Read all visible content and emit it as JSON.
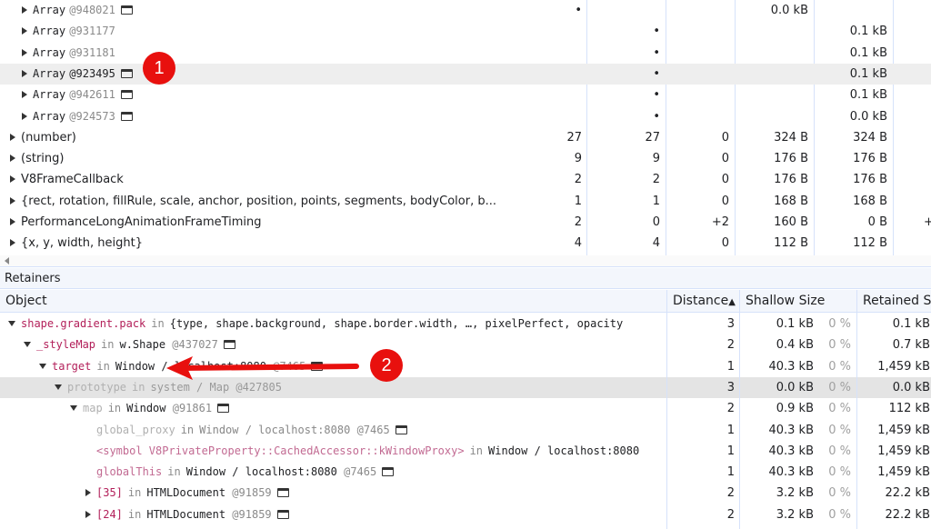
{
  "top_table": {
    "rows": [
      {
        "indent": 2,
        "name": "Array",
        "id": "@948021",
        "win": true,
        "c1": "•",
        "c2": "",
        "c3": "",
        "c4": "0.0 kB",
        "c5": "",
        "c6": ""
      },
      {
        "indent": 2,
        "name": "Array",
        "id": "@931177",
        "win": false,
        "c1": "",
        "c2": "•",
        "c3": "",
        "c4": "",
        "c5": "0.1 kB",
        "c6": ""
      },
      {
        "indent": 2,
        "name": "Array",
        "id": "@931181",
        "win": false,
        "c1": "",
        "c2": "•",
        "c3": "",
        "c4": "",
        "c5": "0.1 kB",
        "c6": ""
      },
      {
        "indent": 2,
        "name": "Array",
        "id": "@923495",
        "win": true,
        "selected": true,
        "c1": "",
        "c2": "•",
        "c3": "",
        "c4": "",
        "c5": "0.1 kB",
        "c6": ""
      },
      {
        "indent": 2,
        "name": "Array",
        "id": "@942611",
        "win": true,
        "c1": "",
        "c2": "•",
        "c3": "",
        "c4": "",
        "c5": "0.1 kB",
        "c6": ""
      },
      {
        "indent": 2,
        "name": "Array",
        "id": "@924573",
        "win": true,
        "c1": "",
        "c2": "•",
        "c3": "",
        "c4": "",
        "c5": "0.0 kB",
        "c6": ""
      },
      {
        "indent": 1,
        "name": "(number)",
        "c1": "27",
        "c2": "27",
        "c3": "0",
        "c4": "324 B",
        "c5": "324 B",
        "c6": ""
      },
      {
        "indent": 1,
        "name": "(string)",
        "c1": "9",
        "c2": "9",
        "c3": "0",
        "c4": "176 B",
        "c5": "176 B",
        "c6": ""
      },
      {
        "indent": 1,
        "name": "V8FrameCallback",
        "c1": "2",
        "c2": "2",
        "c3": "0",
        "c4": "176 B",
        "c5": "176 B",
        "c6": ""
      },
      {
        "indent": 1,
        "name": "{rect, rotation, fillRule, scale, anchor, position, points, segments, bodyColor, b...",
        "c1": "1",
        "c2": "1",
        "c3": "0",
        "c4": "168 B",
        "c5": "168 B",
        "c6": ""
      },
      {
        "indent": 1,
        "name": "PerformanceLongAnimationFrameTiming",
        "c1": "2",
        "c2": "0",
        "c3": "+2",
        "c4": "160 B",
        "c5": "0 B",
        "c6": "+"
      },
      {
        "indent": 1,
        "name": "{x, y, width, height}",
        "c1": "4",
        "c2": "4",
        "c3": "0",
        "c4": "112 B",
        "c5": "112 B",
        "c6": ""
      }
    ]
  },
  "retainers": {
    "title": "Retainers",
    "columns": {
      "object": "Object",
      "distance": "Distance",
      "shallow": "Shallow Size",
      "retained": "Retained Size"
    },
    "rows": [
      {
        "level": 0,
        "arrow": "down",
        "prop": "shape.gradient.pack",
        "style": "prop",
        "in": "in",
        "obj": "{type, shape.background, shape.border.width, …, pixelPerfect, opacity",
        "id": "",
        "win": false,
        "distance": "3",
        "shallow": "0.1 kB",
        "shallow_pct": "0 %",
        "retained": "0.1 kB"
      },
      {
        "level": 1,
        "arrow": "down",
        "prop": "_styleMap",
        "style": "prop",
        "in": "in",
        "obj": "w.Shape",
        "id": "@437027",
        "win": true,
        "distance": "2",
        "shallow": "0.4 kB",
        "shallow_pct": "0 %",
        "retained": "0.7 kB"
      },
      {
        "level": 2,
        "arrow": "down",
        "prop": "target",
        "style": "prop",
        "in": "in",
        "obj": "Window / localhost:8080",
        "id": "@7465",
        "win": true,
        "distance": "1",
        "shallow": "40.3 kB",
        "shallow_pct": "0 %",
        "retained": "1,459 kB"
      },
      {
        "level": 3,
        "arrow": "down",
        "prop": "prototype",
        "style": "grayp",
        "in": "in",
        "obj": "system / Map",
        "id": "@427805",
        "win": false,
        "selected": true,
        "faded": true,
        "distance": "3",
        "shallow": "0.0 kB",
        "shallow_pct": "0 %",
        "retained": "0.0 kB"
      },
      {
        "level": 4,
        "arrow": "down",
        "prop": "map",
        "style": "grayp",
        "in": "in",
        "obj": "Window",
        "id": "@91861",
        "win": true,
        "distance": "2",
        "shallow": "0.9 kB",
        "shallow_pct": "0 %",
        "retained": "112 kB"
      },
      {
        "level": 5,
        "arrow": "",
        "prop": "global_proxy",
        "style": "grayp",
        "in": "in",
        "obj": "Window / localhost:8080",
        "id": "@7465",
        "win": true,
        "distance": "1",
        "shallow": "40.3 kB",
        "shallow_pct": "0 %",
        "retained": "1,459 kB"
      },
      {
        "level": 5,
        "arrow": "",
        "prop": "<symbol V8PrivateProperty::CachedAccessor::kWindowProxy>",
        "style": "propfade",
        "in": "in",
        "obj": "Window / localhost:8080",
        "id": "",
        "win": false,
        "distance": "1",
        "shallow": "40.3 kB",
        "shallow_pct": "0 %",
        "retained": "1,459 kB"
      },
      {
        "level": 5,
        "arrow": "",
        "prop": "globalThis",
        "style": "propfade",
        "in": "in",
        "obj": "Window / localhost:8080",
        "id": "@7465",
        "win": true,
        "distance": "1",
        "shallow": "40.3 kB",
        "shallow_pct": "0 %",
        "retained": "1,459 kB"
      },
      {
        "level": 5,
        "arrow": "right",
        "prop": "[35]",
        "style": "prop",
        "in": "in",
        "obj": "HTMLDocument",
        "id": "@91859",
        "win": true,
        "distance": "2",
        "shallow": "3.2 kB",
        "shallow_pct": "0 %",
        "retained": "22.2 kB"
      },
      {
        "level": 5,
        "arrow": "right",
        "prop": "[24]",
        "style": "prop",
        "in": "in",
        "obj": "HTMLDocument",
        "id": "@91859",
        "win": true,
        "distance": "2",
        "shallow": "3.2 kB",
        "shallow_pct": "0 %",
        "retained": "22.2 kB"
      }
    ]
  },
  "annotations": [
    {
      "label": "1"
    },
    {
      "label": "2"
    }
  ],
  "colors": {
    "annotation": "#e8100e",
    "property": "#b3205a",
    "grid": "#d6e2fa"
  }
}
